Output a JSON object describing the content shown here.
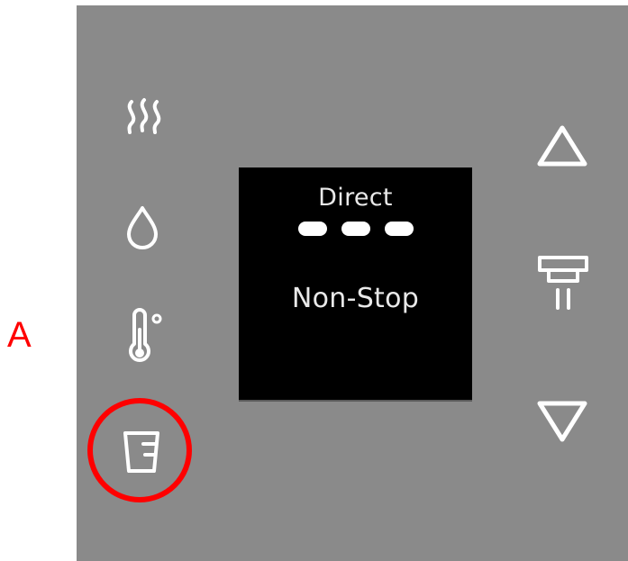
{
  "annotation": {
    "label": "A",
    "color": "#ff0000"
  },
  "panel": {
    "background": "#8a8a8a",
    "left_buttons": [
      {
        "name": "steam-icon",
        "action": "steam"
      },
      {
        "name": "water-drop-icon",
        "action": "hot-water"
      },
      {
        "name": "thermometer-icon",
        "action": "temperature"
      },
      {
        "name": "cup-icon",
        "action": "cup-volume"
      }
    ],
    "right_buttons": [
      {
        "name": "arrow-up-icon",
        "action": "increase"
      },
      {
        "name": "dispenser-icon",
        "action": "start-dispense"
      },
      {
        "name": "arrow-down-icon",
        "action": "decrease"
      }
    ]
  },
  "display": {
    "mode": "Direct",
    "level_count": 3,
    "volume": "Non-Stop"
  }
}
